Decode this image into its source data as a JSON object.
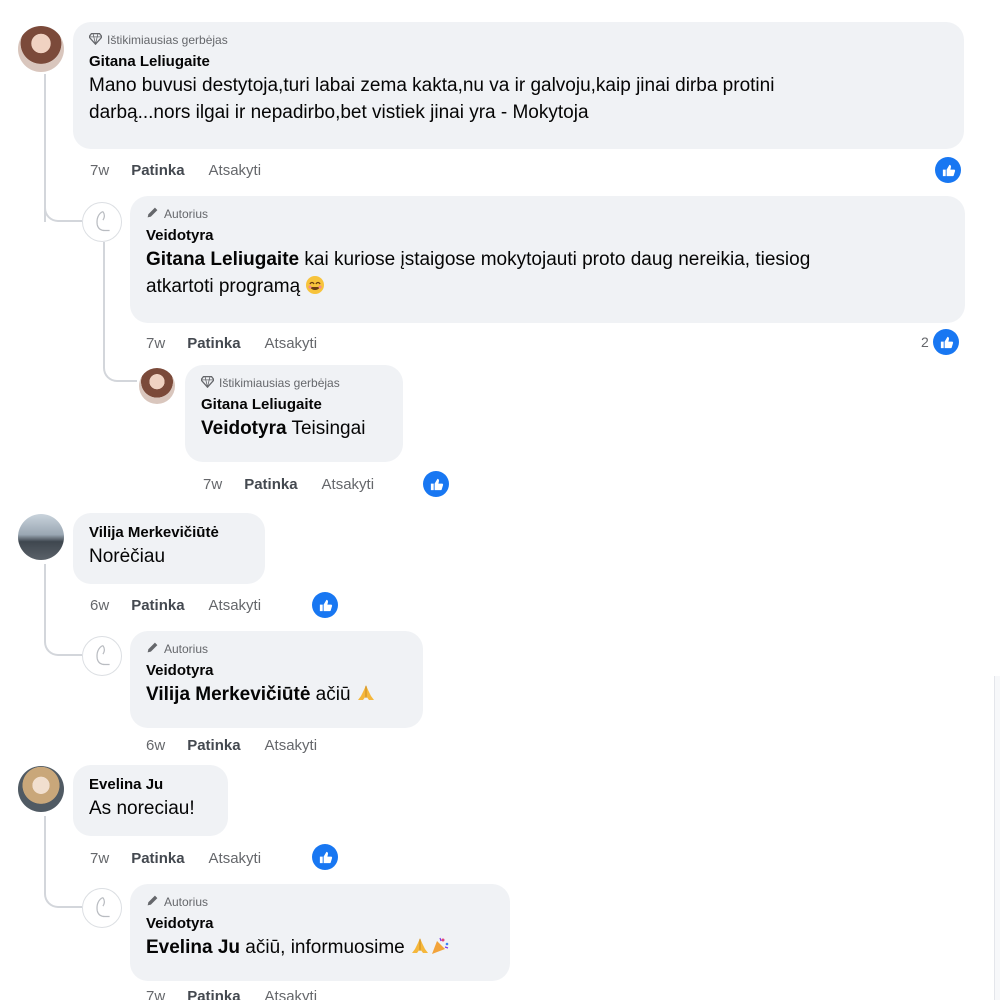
{
  "badges": {
    "fan": "Ištikimiausias gerbėjas",
    "author": "Autorius"
  },
  "actions": {
    "like": "Patinka",
    "reply": "Atsakyti"
  },
  "comments": [
    {
      "name": "Gitana Leliugaite",
      "badge": "Ištikimiausias gerbėjas",
      "text_line1": "Mano buvusi destytoja,turi labai zema kakta,nu va ir galvoju,kaip jinai dirba protini",
      "text_line2": "darbą...nors ilgai ir nepadirbo,bet vistiek jinai yra - Mokytoja",
      "time": "7w",
      "replies": [
        {
          "name": "Veidotyra",
          "badge": "Autorius",
          "mention": "Gitana Leliugaite",
          "text_line1": " kai kuriose įstaigose mokytojauti proto daug nereikia, tiesiog",
          "text_line2": "atkartoti programą",
          "time": "7w",
          "like_count": "2"
        },
        {
          "name": "Gitana Leliugaite",
          "badge": "Ištikimiausias gerbėjas",
          "mention": "Veidotyra",
          "text": " Teisingai",
          "time": "7w"
        }
      ]
    },
    {
      "name": "Vilija Merkevičiūtė",
      "text": "Norėčiau",
      "time": "6w",
      "replies": [
        {
          "name": "Veidotyra",
          "badge": "Autorius",
          "mention": "Vilija Merkevičiūtė",
          "text": " ačiū",
          "time": "6w"
        }
      ]
    },
    {
      "name": "Evelina Ju",
      "text": "As noreciau!",
      "time": "7w",
      "replies": [
        {
          "name": "Veidotyra",
          "badge": "Autorius",
          "mention": "Evelina Ju",
          "text": " ačiū, informuosime",
          "time": "7w"
        }
      ]
    }
  ],
  "colors": {
    "like_blue": "#1877f2",
    "bubble": "#f0f2f5",
    "meta_gray": "#65676b"
  },
  "icons": [
    "diamond-icon",
    "pen-icon",
    "like-thumb-icon",
    "smile-emoji-icon",
    "praying-hands-emoji-icon",
    "party-popper-emoji-icon"
  ]
}
